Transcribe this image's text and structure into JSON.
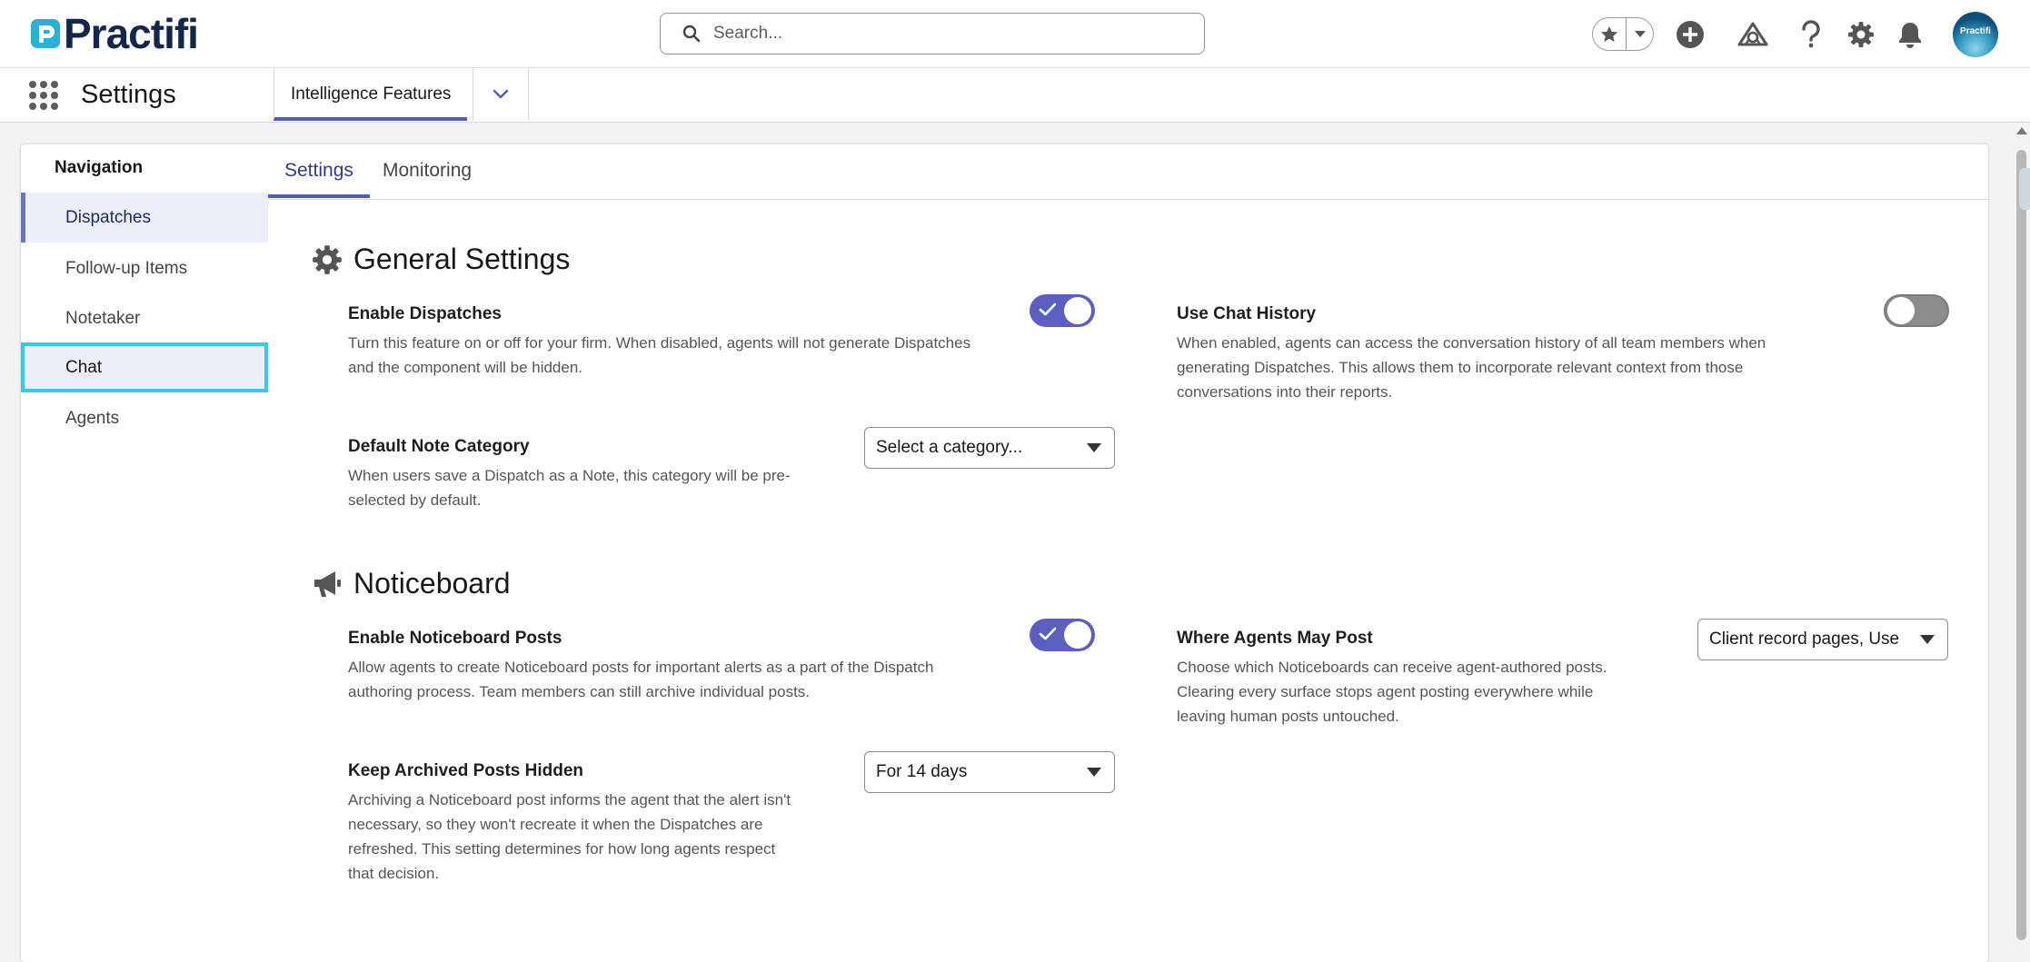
{
  "header": {
    "brand": "Practifi",
    "search_placeholder": "Search...",
    "avatar_text": "Practifi",
    "icons": [
      "favorites-star-icon",
      "favorites-dropdown-icon",
      "add-icon",
      "trailhead-icon",
      "help-icon",
      "setup-gear-icon",
      "notifications-bell-icon"
    ]
  },
  "app_bar": {
    "app_name": "Settings",
    "tab_label": "Intelligence Features"
  },
  "nav": {
    "title": "Navigation",
    "items": [
      {
        "label": "Dispatches"
      },
      {
        "label": "Follow-up Items"
      },
      {
        "label": "Notetaker"
      },
      {
        "label": "Chat"
      },
      {
        "label": "Agents"
      }
    ]
  },
  "tabs": [
    {
      "label": "Settings"
    },
    {
      "label": "Monitoring"
    }
  ],
  "general": {
    "title": "General Settings",
    "enable_dispatches": {
      "label": "Enable Dispatches",
      "desc_lines": [
        "Turn this feature on or off for your firm. When disabled, agents will not generate Dispatches",
        "and the component will be hidden."
      ],
      "enabled": true
    },
    "use_chat_history": {
      "label": "Use Chat History",
      "desc_lines": [
        "When enabled, agents can access the conversation history of all team members when",
        "generating Dispatches. This allows them to incorporate relevant context from those",
        "conversations into their reports."
      ],
      "enabled": false
    },
    "default_note_category": {
      "label": "Default Note Category",
      "desc_lines": [
        "When users save a Dispatch as a Note, this category will be pre-",
        "selected by default."
      ],
      "value": "Select a category..."
    }
  },
  "noticeboard": {
    "title": "Noticeboard",
    "enable_posts": {
      "label": "Enable Noticeboard Posts",
      "desc_lines": [
        "Allow agents to create Noticeboard posts for important alerts as a part of the Dispatch",
        "authoring process. Team members can still archive individual posts."
      ],
      "enabled": true
    },
    "where_agents_post": {
      "label": "Where Agents May Post",
      "desc_lines": [
        "Choose which Noticeboards can receive agent-authored posts.",
        "Clearing every surface stops agent posting everywhere while",
        "leaving human posts untouched."
      ],
      "value": "Client record pages, Use"
    },
    "keep_archived_hidden": {
      "label": "Keep Archived Posts Hidden",
      "desc_lines": [
        "Archiving a Noticeboard post informs the agent that the alert isn't",
        "necessary, so they won't recreate it when the Dispatches are",
        "refreshed. This setting determines for how long agents respect",
        "that decision."
      ],
      "value": "For 14 days"
    }
  },
  "colors": {
    "accent": "#4f5db5",
    "toggle_on": "#5c5fc0",
    "toggle_off": "#8c8c8c",
    "focus_ring": "#36c8ee",
    "brand_text": "#14264a"
  }
}
